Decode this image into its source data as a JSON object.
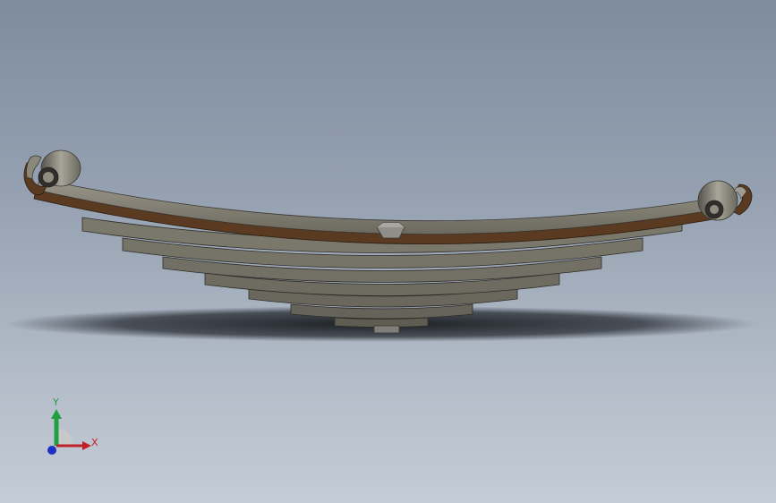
{
  "viewport": {
    "background_top": "#7e8c9e",
    "background_bottom": "#c4ccd6"
  },
  "model": {
    "name": "leaf-spring-assembly",
    "leaf_count": 8,
    "colors": {
      "leaf_light": "#8a8676",
      "leaf_mid": "#6e6b5f",
      "leaf_dark": "#3f3d36",
      "leaf_edge_brown": "#5a3a20",
      "bolt": "#8f8e88",
      "shadow": "#1a1d22"
    }
  },
  "triad": {
    "x_label": "X",
    "y_label": "Y",
    "x_color": "#c0202a",
    "y_color": "#20a040",
    "z_color": "#2030c0"
  }
}
